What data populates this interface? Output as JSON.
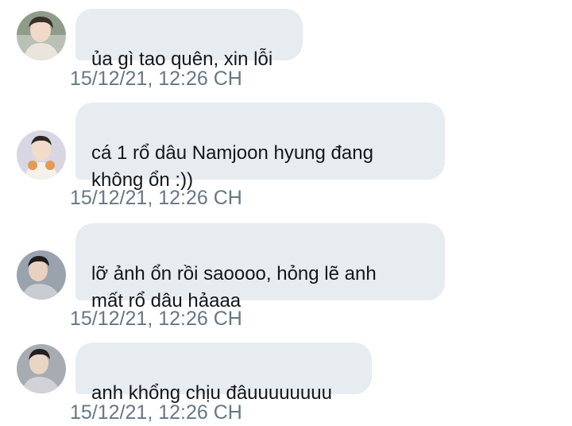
{
  "messages": [
    {
      "text": "ủa gì tao quên, xin lỗi",
      "timestamp": "15/12/21, 12:26 CH"
    },
    {
      "text": "cá 1 rổ dâu Namjoon hyung đang\nkhông ổn :))",
      "timestamp": "15/12/21, 12:26 CH"
    },
    {
      "text": "lỡ ảnh ổn rồi saoooo, hỏng lẽ anh\nmất rổ dâu hảaaa",
      "timestamp": "15/12/21, 12:26 CH"
    },
    {
      "text": "anh khổng chịu đâuuuuuuuu",
      "timestamp": "15/12/21, 12:26 CH"
    }
  ],
  "colors": {
    "bubble": "#e6ecf0",
    "text": "#14171a",
    "timestamp": "#657786"
  }
}
